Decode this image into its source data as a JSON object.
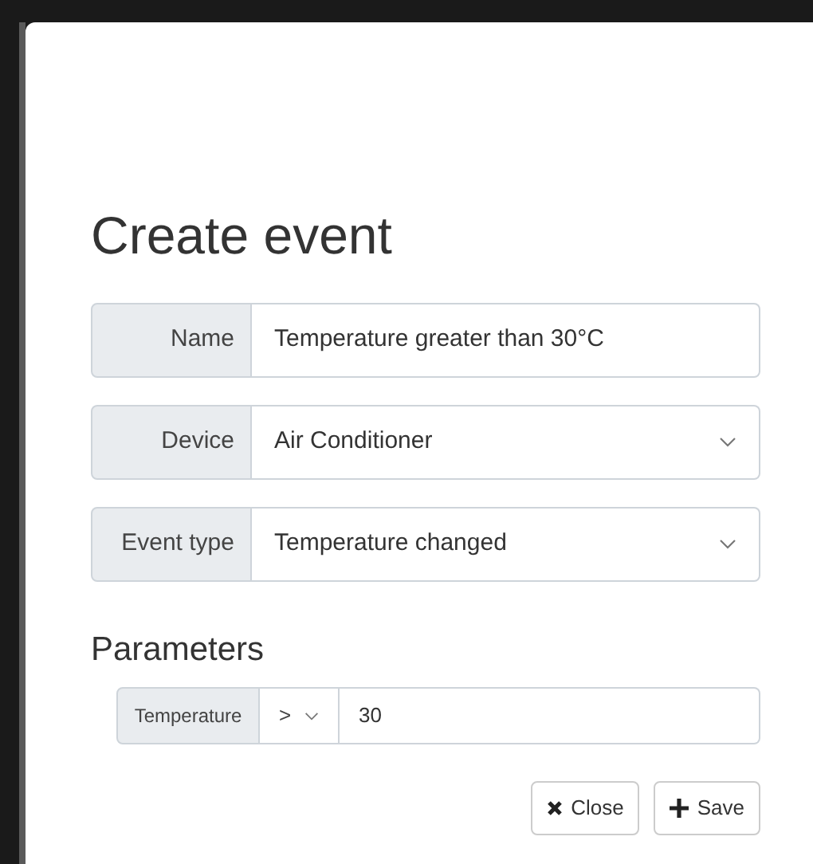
{
  "modal": {
    "title": "Create event",
    "fields": [
      {
        "kind": "text",
        "label": "Name",
        "value": "Temperature greater than 30°C"
      },
      {
        "kind": "select",
        "label": "Device",
        "value": "Air Conditioner"
      },
      {
        "kind": "select",
        "label": "Event type",
        "value": "Temperature changed"
      }
    ],
    "parameters": {
      "heading": "Parameters",
      "rows": [
        {
          "label": "Temperature",
          "operator": ">",
          "value": "30"
        }
      ]
    },
    "buttons": [
      {
        "kind": "close",
        "label": "Close"
      },
      {
        "kind": "save",
        "label": "Save"
      }
    ]
  }
}
